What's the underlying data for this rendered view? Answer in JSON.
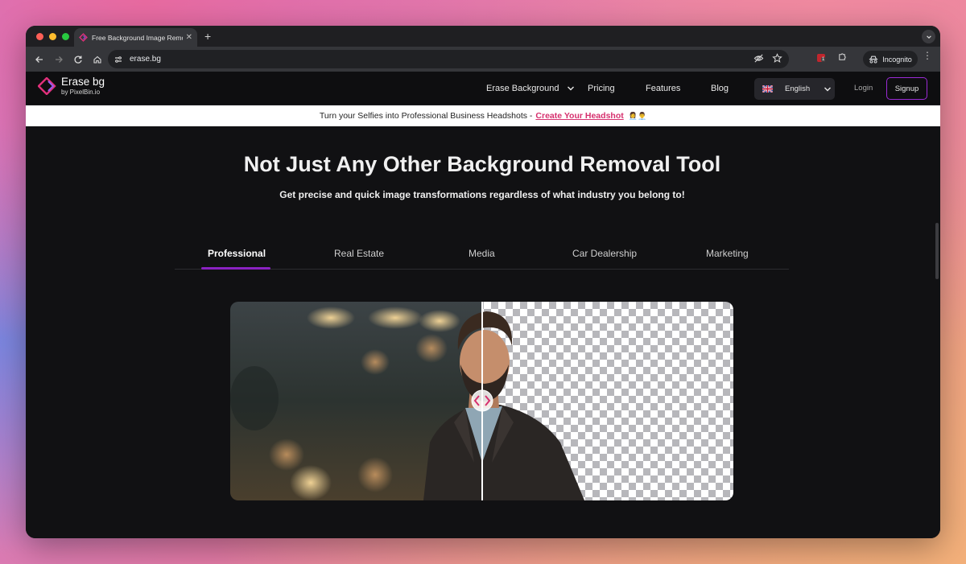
{
  "browser": {
    "tab_title": "Free Background Image Remover",
    "url": "erase.bg",
    "profile_label": "Incognito",
    "extension_badge": "1"
  },
  "site": {
    "logo_name": "Erase bg",
    "logo_by": "by PixelBin.io",
    "nav": {
      "erase_background": "Erase Background",
      "pricing": "Pricing",
      "features": "Features",
      "blog": "Blog"
    },
    "language": "English",
    "login": "Login",
    "signup": "Signup"
  },
  "banner": {
    "text": "Turn your Selfies into Professional Business Headshots -",
    "link": "Create Your Headshot",
    "emoji": "👩‍💼👨‍💼"
  },
  "hero": {
    "title": "Not Just Any Other Background Removal Tool",
    "subtitle": "Get precise and quick image transformations regardless of what industry you belong to!"
  },
  "industry_tabs": {
    "active": "Professional",
    "items": [
      "Professional",
      "Real Estate",
      "Media",
      "Car Dealership",
      "Marketing"
    ]
  },
  "compare": {
    "slider_position": 0.5
  },
  "colors": {
    "accent": "#8a22c2",
    "banner_link": "#d6306e",
    "logo": "#e0307a"
  }
}
